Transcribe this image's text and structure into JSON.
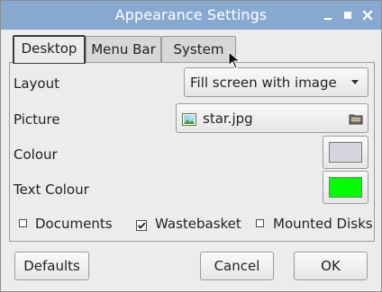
{
  "window": {
    "title": "Appearance Settings"
  },
  "tabs": [
    {
      "label": "Desktop",
      "active": true
    },
    {
      "label": "Menu Bar",
      "active": false
    },
    {
      "label": "System",
      "active": false
    }
  ],
  "desktop": {
    "layout_label": "Layout",
    "layout_value": "Fill screen with image",
    "picture_label": "Picture",
    "picture_file": "star.jpg",
    "colour_label": "Colour",
    "colour_value": "#d8d4df",
    "text_colour_label": "Text Colour",
    "text_colour_value": "#00ff00",
    "checkboxes": [
      {
        "label": "Documents",
        "checked": false
      },
      {
        "label": "Wastebasket",
        "checked": true
      },
      {
        "label": "Mounted Disks",
        "checked": false
      }
    ]
  },
  "buttons": {
    "defaults": "Defaults",
    "cancel": "Cancel",
    "ok": "OK"
  },
  "icons": {
    "minimize": "minimize-icon",
    "maximize": "maximize-icon",
    "close": "close-icon",
    "image_file": "image-file-icon",
    "folder_open": "folder-open-icon",
    "dropdown": "chevron-down-icon",
    "check": "checkmark-icon",
    "cursor": "mouse-pointer-icon"
  },
  "colors": {
    "titlebar": "#87a9cf",
    "window_bg": "#ececec"
  }
}
